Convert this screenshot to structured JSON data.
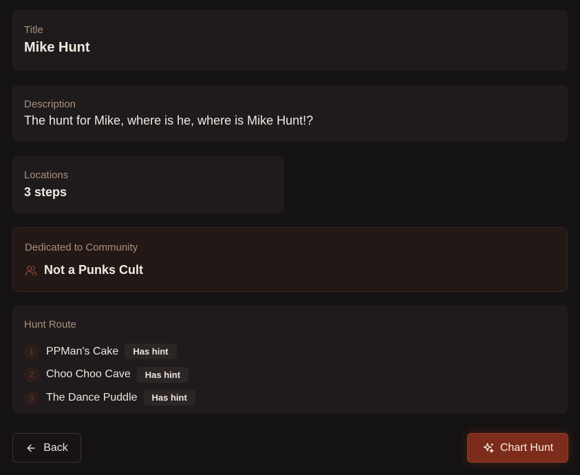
{
  "title_card": {
    "label": "Title",
    "value": "Mike Hunt"
  },
  "description_card": {
    "label": "Description",
    "value": "The hunt for Mike, where is he, where is Mike Hunt!?"
  },
  "locations_card": {
    "label": "Locations",
    "value": "3 steps"
  },
  "community_card": {
    "label": "Dedicated to Community",
    "icon": "users-icon",
    "name": "Not a Punks Cult"
  },
  "route_card": {
    "label": "Hunt Route",
    "steps": [
      {
        "number": "1",
        "name": "PPMan's Cake",
        "badge": "Has hint"
      },
      {
        "number": "2",
        "name": "Choo Choo Cave",
        "badge": "Has hint"
      },
      {
        "number": "3",
        "name": "The Dance Puddle",
        "badge": "Has hint"
      }
    ]
  },
  "actions": {
    "back_label": "Back",
    "back_icon": "arrow-left-icon",
    "chart_label": "Chart Hunt",
    "chart_icon": "sparkles-icon"
  },
  "colors": {
    "background": "#151213",
    "card": "#1f1b1c",
    "accent": "#7c2c1b",
    "label": "#a98f7c"
  }
}
